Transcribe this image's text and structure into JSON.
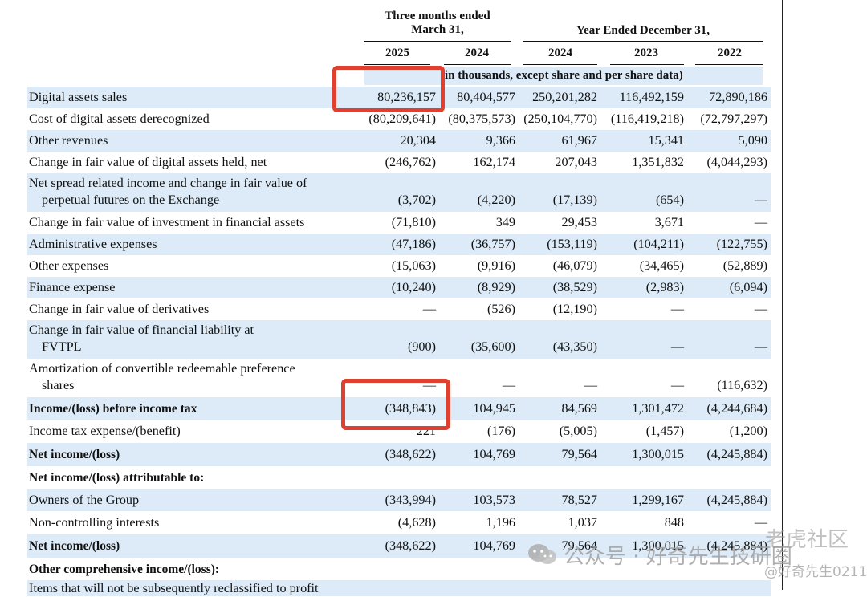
{
  "header": {
    "three_months": "Three months ended\nMarch 31,",
    "year_ended": "Year Ended December 31,",
    "years": [
      "2025",
      "2024",
      "2024",
      "2023",
      "2022"
    ],
    "units": "in thousands, except share and per share data)"
  },
  "rows": [
    {
      "label": "Digital assets sales",
      "values": [
        "80,236,157",
        "80,404,577",
        "250,201,282",
        "116,492,159",
        "72,890,186"
      ]
    },
    {
      "label": "Cost of digital assets derecognized",
      "values": [
        "(80,209,641)",
        "(80,375,573)",
        "(250,104,770)",
        "(116,419,218)",
        "(72,797,297)"
      ]
    },
    {
      "label": "Other revenues",
      "values": [
        "20,304",
        "9,366",
        "61,967",
        "15,341",
        "5,090"
      ]
    },
    {
      "label": "Change in fair value of digital assets held, net",
      "values": [
        "(246,762)",
        "162,174",
        "207,043",
        "1,351,832",
        "(4,044,293)"
      ]
    },
    {
      "label": "Net spread related income and change in fair value of",
      "label2": "perpetual futures on the Exchange",
      "values": [
        "(3,702)",
        "(4,220)",
        "(17,139)",
        "(654)",
        "—"
      ]
    },
    {
      "label": "Change in fair value of investment in financial assets",
      "values": [
        "(71,810)",
        "349",
        "29,453",
        "3,671",
        "—"
      ]
    },
    {
      "label": "Administrative expenses",
      "values": [
        "(47,186)",
        "(36,757)",
        "(153,119)",
        "(104,211)",
        "(122,755)"
      ]
    },
    {
      "label": "Other expenses",
      "values": [
        "(15,063)",
        "(9,916)",
        "(46,079)",
        "(34,465)",
        "(52,889)"
      ]
    },
    {
      "label": "Finance expense",
      "values": [
        "(10,240)",
        "(8,929)",
        "(38,529)",
        "(2,983)",
        "(6,094)"
      ]
    },
    {
      "label": "Change in fair value of derivatives",
      "values": [
        "—",
        "(526)",
        "(12,190)",
        "—",
        "—"
      ]
    },
    {
      "label": "Change in fair value of financial liability at",
      "label2": "FVTPL",
      "values": [
        "(900)",
        "(35,600)",
        "(43,350)",
        "—",
        "—"
      ]
    },
    {
      "label": "Amortization of convertible redeemable preference",
      "label2": "shares",
      "values": [
        "—",
        "—",
        "—",
        "—",
        "(116,632)"
      ]
    },
    {
      "label": "Income/(loss) before income tax",
      "bold": true,
      "values": [
        "(348,843)",
        "104,945",
        "84,569",
        "1,301,472",
        "(4,244,684)"
      ]
    },
    {
      "label": "Income tax expense/(benefit)",
      "values": [
        "221",
        "(176)",
        "(5,005)",
        "(1,457)",
        "(1,200)"
      ]
    },
    {
      "label": "Net income/(loss)",
      "bold": true,
      "values": [
        "(348,622)",
        "104,769",
        "79,564",
        "1,300,015",
        "(4,245,884)"
      ]
    },
    {
      "label": "Net income/(loss) attributable to:",
      "bold": true,
      "values": [
        "",
        "",
        "",
        "",
        ""
      ]
    },
    {
      "label": "Owners of the Group",
      "values": [
        "(343,994)",
        "103,573",
        "78,527",
        "1,299,167",
        "(4,245,884)"
      ]
    },
    {
      "label": "Non-controlling interests",
      "values": [
        "(4,628)",
        "1,196",
        "1,037",
        "848",
        "—"
      ]
    },
    {
      "label": "Net income/(loss)",
      "bold": true,
      "values": [
        "(348,622)",
        "104,769",
        "79,564",
        "1,300,015",
        "(4,245,884)"
      ]
    },
    {
      "label": "Other comprehensive income/(loss):",
      "bold": true,
      "values": [
        "",
        "",
        "",
        "",
        ""
      ]
    },
    {
      "label": "Items that will not be subsequently reclassified to profit",
      "values": [
        "",
        "",
        "",
        "",
        ""
      ]
    }
  ],
  "watermark": {
    "main": "公众号 · 好奇先生技研圈",
    "corner": "老虎社区",
    "handle": "@好奇先生0211"
  },
  "colors": {
    "shade": "#dcebf7",
    "highlight": "#e04030"
  }
}
